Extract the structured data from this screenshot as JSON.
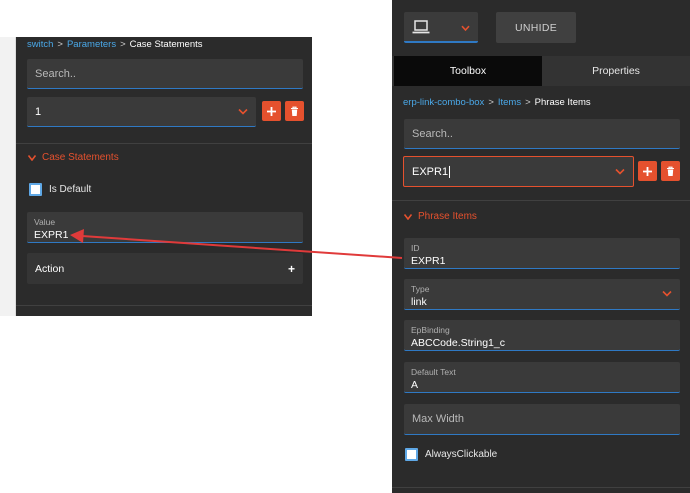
{
  "left": {
    "breadcrumb": [
      "switch",
      "Parameters",
      "Case Statements"
    ],
    "breadcrumb_sep": ">",
    "search_placeholder": "Search..",
    "selected_value": "1",
    "section_title": "Case Statements",
    "is_default_label": "Is Default",
    "value_field": {
      "label": "Value",
      "value": "EXPR1"
    },
    "action_label": "Action",
    "plus_glyph": "+"
  },
  "right": {
    "unhide_label": "UNHIDE",
    "tabs": [
      "Toolbox",
      "Properties"
    ],
    "breadcrumb": [
      "erp-link-combo-box",
      "Items",
      "Phrase Items"
    ],
    "breadcrumb_sep": ">",
    "search_placeholder": "Search..",
    "selected_value": "EXPR1",
    "section_title": "Phrase Items",
    "fields": [
      {
        "label": "ID",
        "value": "EXPR1"
      },
      {
        "label": "Type",
        "value": "link"
      },
      {
        "label": "EpBinding",
        "value": "ABCCode.String1_c"
      },
      {
        "label": "Default Text",
        "value": "A"
      }
    ],
    "max_width_placeholder": "Max Width",
    "always_clickable_label": "AlwaysClickable"
  },
  "colors": {
    "accent_orange": "#e5512e",
    "link_blue": "#4aa8e8",
    "panel_bg": "#2b2b2b",
    "field_bg": "#3a3a3a",
    "arrow_red": "#e03a3a"
  },
  "icons": [
    "laptop-icon",
    "chevron-down-icon",
    "plus-icon",
    "trash-icon",
    "triangle-down-icon",
    "checkbox-icon"
  ]
}
